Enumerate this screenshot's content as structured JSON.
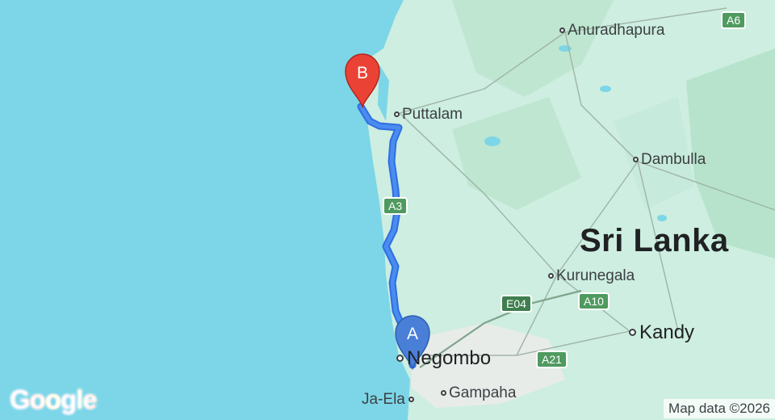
{
  "map": {
    "colors": {
      "water": "#7dd6e8",
      "land": "#cdeee0",
      "land_dark": "#b7e3cc",
      "route": "#4285f4",
      "marker_a": "#4a7fd8",
      "marker_b": "#ea4335"
    },
    "country_label": "Sri Lanka",
    "cities": [
      {
        "id": "anuradhapura",
        "name": "Anuradhapura"
      },
      {
        "id": "puttalam",
        "name": "Puttalam"
      },
      {
        "id": "dambulla",
        "name": "Dambulla"
      },
      {
        "id": "kurunegala",
        "name": "Kurunegala"
      },
      {
        "id": "kandy",
        "name": "Kandy"
      },
      {
        "id": "negombo",
        "name": "Negombo"
      },
      {
        "id": "ja-ela",
        "name": "Ja-Ela"
      },
      {
        "id": "gampaha",
        "name": "Gampaha"
      }
    ],
    "road_shields": [
      {
        "id": "a6",
        "label": "A6"
      },
      {
        "id": "a3",
        "label": "A3"
      },
      {
        "id": "e04",
        "label": "E04"
      },
      {
        "id": "a10",
        "label": "A10"
      },
      {
        "id": "a21",
        "label": "A21"
      }
    ],
    "markers": [
      {
        "id": "origin",
        "label": "A"
      },
      {
        "id": "destination",
        "label": "B"
      }
    ],
    "logo": "Google",
    "attribution": "Map data ©2026"
  }
}
